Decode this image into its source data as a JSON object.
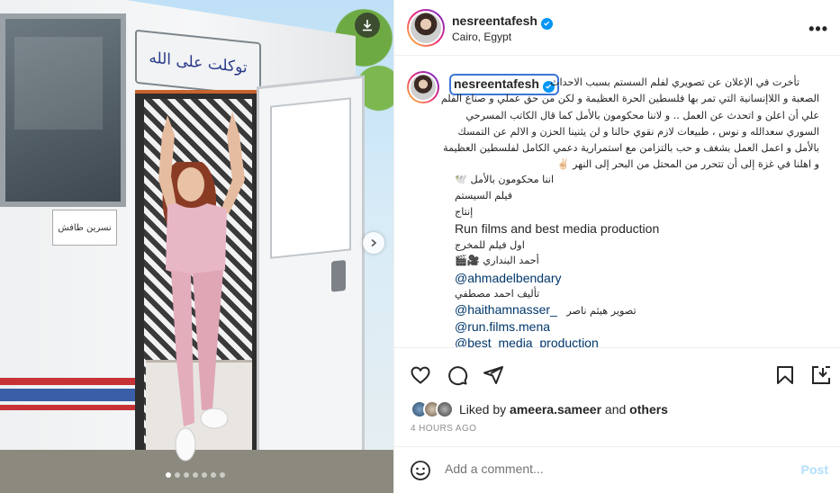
{
  "post": {
    "username": "nesreentafesh",
    "location": "Cairo, Egypt",
    "bus_sign_text": "توكلت على الله",
    "name_tag_text": "نسرين طافش",
    "caption": {
      "username": "nesreentafesh",
      "lines": [
        "تأخرت في الإعلان عن تصويري لفلم السستم بسبب الاحداث",
        "الصعبة و اللاإنسانية التي تمر بها فلسطين الحرة العظيمة و لكن من حق عملي و صناع الفلم",
        "علي أن اعلن و اتحدث عن العمل .. و لاننا محكومون بالأمل كما قال الكاتب المسرحي",
        "السوري سعدالله و نوس ، طبيعات لازم نقوي حالنا و لن يثنينا الحزن و الالم عن التمسك",
        "بالأمل و اعمل العمل بشغف و حب بالتزامن مع استمرارية دعمي الكامل لفلسطين العظيمة",
        "و اهلنا في غزة إلى أن تتحرر من المحتل من البحر إلى النهر ✌🏻",
        "اننا محكومون بالأمل 🕊️",
        "فيلم السيستم",
        "إنتاج"
      ],
      "production": "Run films and best media production",
      "first_film_line": "اول فيلم للمخرج",
      "director": "أحمد البنداري 🎥🎬",
      "mention_director": "@ahmadelbendary",
      "writer_line": "تأليف احمد مصطفي",
      "mention_photographer": "@haithamnasser_",
      "photo_credit": "تصوير هيثم ناصر",
      "mention_run": "@run.films.mena",
      "mention_best": "@best_media_production"
    },
    "liked_by_prefix": "Liked by",
    "liked_by_user": "ameera.sameer",
    "liked_by_and": "and",
    "liked_by_others": "others",
    "timestamp": "4 HOURS AGO",
    "comment_placeholder": "Add a comment...",
    "post_label": "Post",
    "carousel": {
      "count": 7,
      "active_index": 0
    }
  },
  "colors": {
    "accent_blue": "#0095f6",
    "link": "#00376b",
    "post_disabled": "#b2dffc",
    "muted": "#8e8e8e"
  },
  "icons": [
    "download-icon",
    "chevron-right-icon",
    "more-icon",
    "verified-icon",
    "heart-icon",
    "comment-icon",
    "share-icon",
    "bookmark-icon",
    "save-to-collection-icon",
    "emoji-icon"
  ]
}
